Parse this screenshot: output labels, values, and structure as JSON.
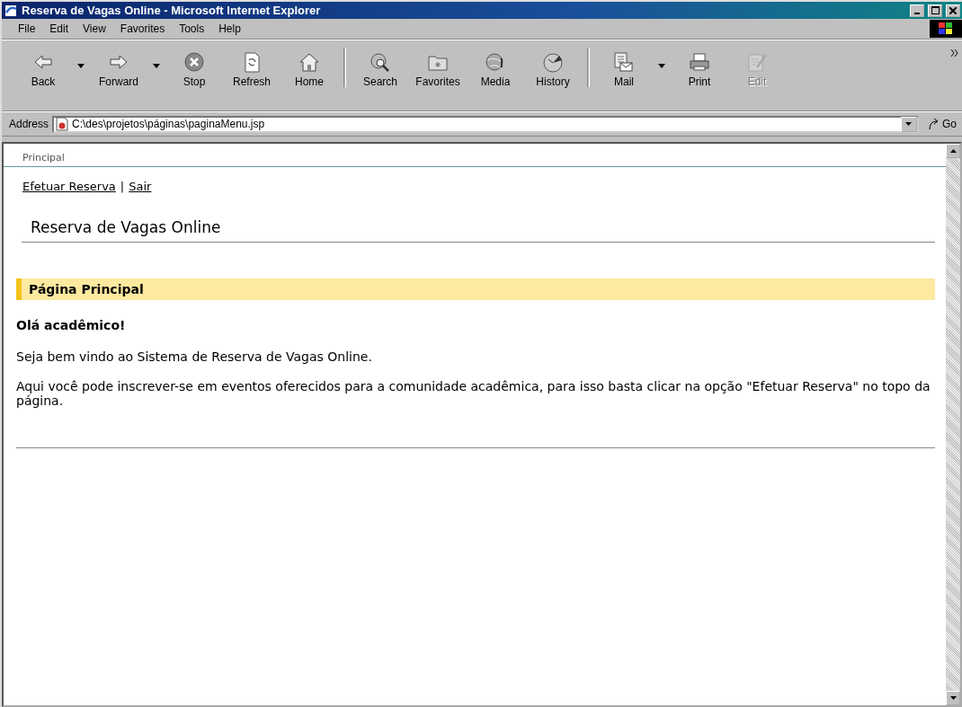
{
  "window": {
    "title": "Reserva de Vagas Online - Microsoft Internet Explorer"
  },
  "menu": [
    "File",
    "Edit",
    "View",
    "Favorites",
    "Tools",
    "Help"
  ],
  "toolbar": [
    {
      "label": "Back",
      "dropdown": true,
      "disabled": false,
      "separator_before": false
    },
    {
      "label": "Forward",
      "dropdown": true,
      "disabled": false,
      "separator_before": false
    },
    {
      "label": "Stop",
      "dropdown": false,
      "disabled": false,
      "separator_before": false
    },
    {
      "label": "Refresh",
      "dropdown": false,
      "disabled": false,
      "separator_before": false
    },
    {
      "label": "Home",
      "dropdown": false,
      "disabled": false,
      "separator_before": false
    },
    {
      "label": "Search",
      "dropdown": false,
      "disabled": false,
      "separator_before": true
    },
    {
      "label": "Favorites",
      "dropdown": false,
      "disabled": false,
      "separator_before": false
    },
    {
      "label": "Media",
      "dropdown": false,
      "disabled": false,
      "separator_before": false
    },
    {
      "label": "History",
      "dropdown": false,
      "disabled": false,
      "separator_before": false
    },
    {
      "label": "Mail",
      "dropdown": true,
      "disabled": false,
      "separator_before": true
    },
    {
      "label": "Print",
      "dropdown": false,
      "disabled": false,
      "separator_before": false
    },
    {
      "label": "Edit",
      "dropdown": false,
      "disabled": true,
      "separator_before": false
    }
  ],
  "address": {
    "label": "Address",
    "value": "C:\\des\\projetos\\páginas\\paginaMenu.jsp",
    "go": "Go"
  },
  "page": {
    "breadcrumb": "Principal",
    "links": [
      "Efetuar Reserva",
      "Sair"
    ],
    "link_separator": "|",
    "title": "Reserva de Vagas Online",
    "section": "Página Principal",
    "greeting": "Olá acadêmico!",
    "paragraphs": [
      "Seja bem vindo ao Sistema de Reserva de Vagas Online.",
      "Aqui você pode inscrever-se em eventos oferecidos para a comunidade acadêmica, para isso basta clicar na opção \"Efetuar Reserva\" no topo da página."
    ]
  }
}
